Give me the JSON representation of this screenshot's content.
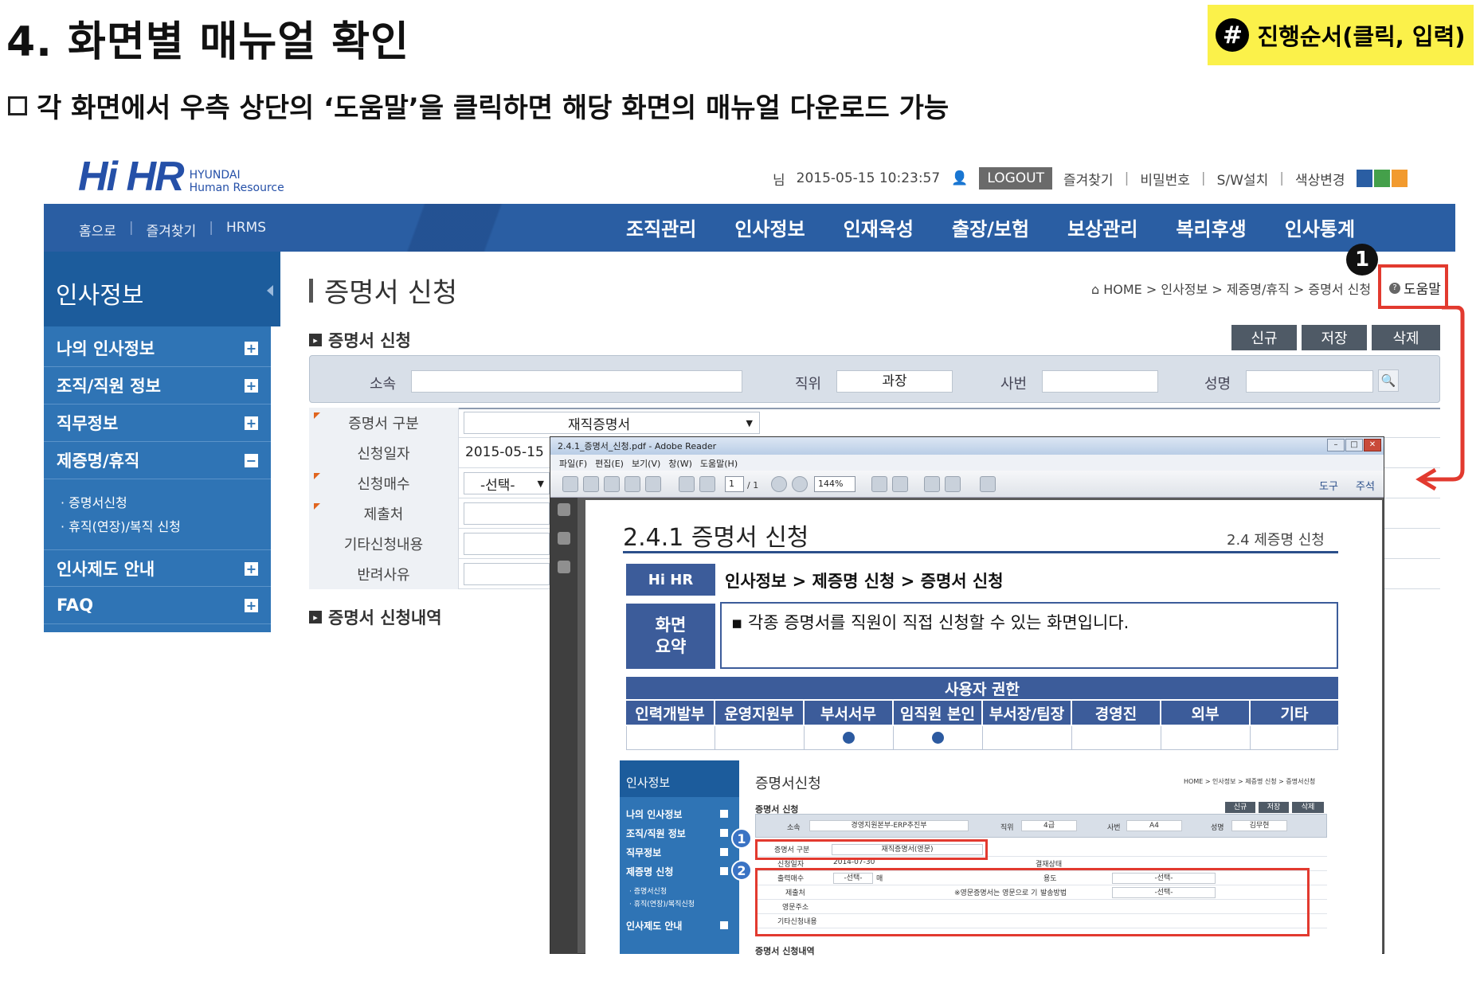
{
  "slide": {
    "title": "4. 화면별 매뉴얼 확인",
    "order_badge_hash": "#",
    "order_badge": "진행순서(클릭, 입력)",
    "bullet": "각 화면에서 우측 상단의 ‘도움말’을 클릭하면 해당 화면의 매뉴얼 다운로드 가능"
  },
  "header": {
    "logo": "Hi HR",
    "logo_sub1": "HYUNDAI",
    "logo_sub2": "Human Resource",
    "user_prefix": "님",
    "datetime": "2015-05-15 10:23:57",
    "logout": "LOGOUT",
    "favorites": "즐겨찾기",
    "password": "비밀번호",
    "sw_install": "S/W설치",
    "color_change": "색상변경",
    "swatch_colors": [
      "#2a5ea3",
      "#44a04a",
      "#f29a2e"
    ]
  },
  "nav": {
    "left": [
      "홈으로",
      "즐겨찾기",
      "HRMS"
    ],
    "main": [
      "조직관리",
      "인사정보",
      "인재육성",
      "출장/보험",
      "보상관리",
      "복리후생",
      "인사통계"
    ]
  },
  "sidebar": {
    "title": "인사정보",
    "items": [
      "나의 인사정보",
      "조직/직원 정보",
      "직무정보",
      "제증명/휴직",
      "인사제도 안내",
      "FAQ"
    ],
    "sub_items": [
      "· 증명서신청",
      "· 휴직(연장)/복직 신청"
    ],
    "plus": "+",
    "minus": "−"
  },
  "main": {
    "title": "증명서 신청",
    "breadcrumb": "HOME > 인사정보 > 제증명/휴직 > 증명서 신청",
    "help": "도움말",
    "section1": "증명서 신청",
    "section2": "증명서 신청내역",
    "buttons": [
      "신규",
      "저장",
      "삭제"
    ],
    "search": {
      "labels": [
        "소속",
        "직위",
        "사번",
        "성명"
      ],
      "position_value": "과장",
      "search_icon": "🔍"
    },
    "form": {
      "rows": [
        {
          "label": "증명서 구분",
          "value": "재직증명서"
        },
        {
          "label": "신청일자",
          "value": "2015-05-15"
        },
        {
          "label": "신청매수",
          "value": "-선택-"
        },
        {
          "label": "제출처",
          "value": ""
        },
        {
          "label": "기타신청내용",
          "value": ""
        },
        {
          "label": "반려사유",
          "value": ""
        }
      ]
    },
    "callout_number": "1"
  },
  "pdf": {
    "window_title": "2.4.1_증명서_신청.pdf - Adobe Reader",
    "menu": [
      "파일(F)",
      "편집(E)",
      "보기(V)",
      "창(W)",
      "도움말(H)"
    ],
    "page_field": "1",
    "page_total": "/ 1",
    "zoom": "144%",
    "tools": "도구",
    "comments": "주석",
    "doc_title": "2.4.1 증명서 신청",
    "doc_subtitle": "2.4 제증명 신청",
    "hihr_tag": "Hi HR",
    "path": "인사정보 > 제증명 신청 > 증명서 신청",
    "summary_label": "화면\n요약",
    "summary_text": "▪ 각종 증명서를 직원이 직접 신청할 수 있는 화면입니다.",
    "permission_title": "사용자 권한",
    "permission_columns": [
      "인력개발부",
      "운영지원부",
      "부서서무",
      "임직원 본인",
      "부서장/팀장",
      "경영진",
      "외부",
      "기타"
    ],
    "permission_marks": [
      false,
      false,
      true,
      true,
      false,
      false,
      false,
      false
    ],
    "mini": {
      "sidebar_title": "인사정보",
      "sidebar_items": [
        "나의 인사정보",
        "조직/직원 정보",
        "직무정보",
        "제증명 신청",
        "인사제도 안내"
      ],
      "sidebar_subs": [
        "· 증명서신청",
        "· 휴직(연장)/복직신청"
      ],
      "title": "증명서신청",
      "breadcrumb": "HOME > 인사정보 > 제증명 신청 > 증명서신청",
      "section1": "증명서 신청",
      "section2": "증명서 신청내역",
      "buttons": [
        "신규",
        "저장",
        "삭제"
      ],
      "search_labels": [
        "소속",
        "직위",
        "사번",
        "성명"
      ],
      "search_values": [
        "경영지원본부-ERP추진부",
        "4급",
        "A4",
        "김무현"
      ],
      "row_labels": [
        "증명서 구분",
        "신청일자",
        "출력매수",
        "제출처",
        "영문주소",
        "기타신청내용"
      ],
      "cert_type": "재직증명서(영문)",
      "date": "2014-07-30",
      "status_label": "결재상태",
      "copies": "-선택-",
      "copies_unit": "매",
      "purpose_label": "용도",
      "purpose_value": "-선택-",
      "delivery_label": "발송방법",
      "delivery_value": "-선택-",
      "submit_note": "※영문증명서는 영문으로 기",
      "numbers": [
        "1",
        "2"
      ]
    }
  }
}
